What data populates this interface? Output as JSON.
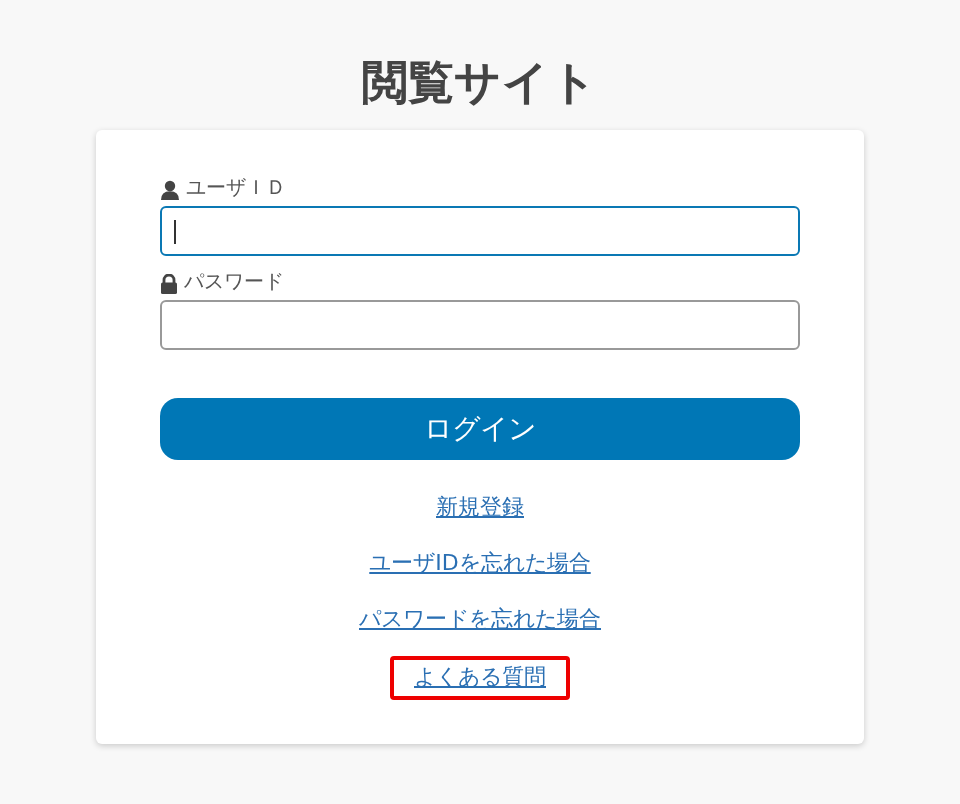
{
  "title": "閲覧サイト",
  "fields": [
    {
      "kind": "user",
      "label": "ユーザＩＤ",
      "focused": true
    },
    {
      "kind": "password",
      "label": "パスワード",
      "focused": false
    }
  ],
  "login_button": "ログイン",
  "links": [
    {
      "label": "新規登録",
      "highlighted": false
    },
    {
      "label": "ユーザIDを忘れた場合",
      "highlighted": false
    },
    {
      "label": "パスワードを忘れた場合",
      "highlighted": false
    },
    {
      "label": "よくある質問",
      "highlighted": true
    }
  ]
}
